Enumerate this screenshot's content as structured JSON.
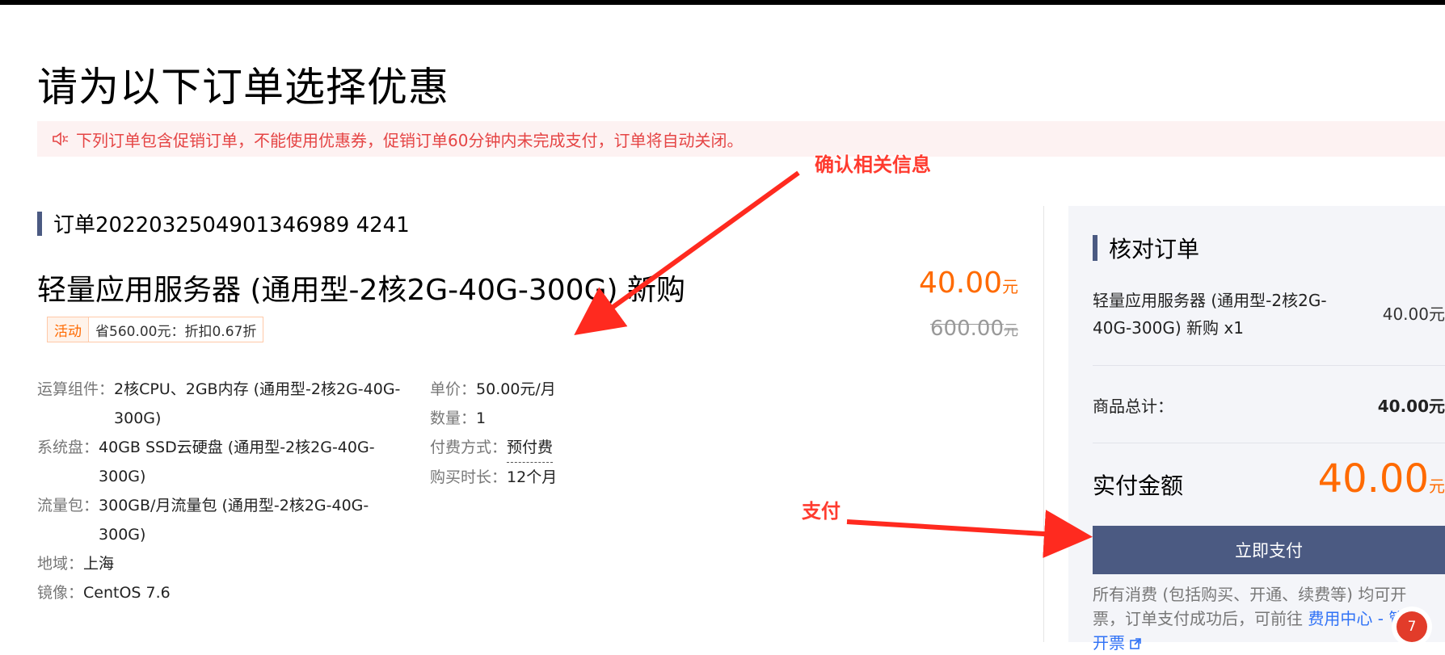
{
  "page": {
    "title": "请为以下订单选择优惠",
    "notice": "下列订单包含促销订单，不能使用优惠券，促销订单60分钟内未完成支付，订单将自动关闭。"
  },
  "order": {
    "id_label": "订单2022032504901346989 4241",
    "product_title": "轻量应用服务器 (通用型-2核2G-40G-300G) 新购",
    "price": "40.00",
    "price_unit": "元",
    "original_price": "600.00",
    "original_unit": "元",
    "promo_tag": "活动",
    "promo_text": "省560.00元：折扣0.67折",
    "specs": [
      {
        "k": "运算组件：",
        "v": "2核CPU、2GB内存 (通用型-2核2G-40G-300G)"
      },
      {
        "k": "系统盘：",
        "v": "40GB SSD云硬盘 (通用型-2核2G-40G-300G)"
      },
      {
        "k": "流量包：",
        "v": "300GB/月流量包 (通用型-2核2G-40G-300G)"
      },
      {
        "k": "地域：",
        "v": "上海"
      },
      {
        "k": "镜像：",
        "v": "CentOS 7.6"
      }
    ],
    "specs2": [
      {
        "k": "单价：",
        "v": "50.00元/月"
      },
      {
        "k": "数量：",
        "v": "1"
      },
      {
        "k": "付费方式：",
        "v": "预付费"
      },
      {
        "k": "购买时长：",
        "v": "12个月"
      }
    ]
  },
  "panel": {
    "title": "核对订单",
    "item": "轻量应用服务器 (通用型-2核2G-40G-300G) 新购 x1",
    "item_price": "40.00元",
    "total_label": "商品总计：",
    "total_value": "40.00元",
    "pay_label": "实付金额",
    "pay_value": "40.00",
    "pay_unit": "元",
    "pay_button": "立即支付",
    "footnote_a": "所有消费 (包括购买、开通、续费等) 均可开票，订单支付成功后，可前往 ",
    "footnote_link": "费用中心 - 管理开票",
    "badge": "7"
  },
  "annotations": {
    "confirm": "确认相关信息",
    "pay": "支付",
    "color": "#ff2a1f"
  },
  "colors": {
    "accent": "#ff6a00",
    "primary": "#4b5a82",
    "notice": "#e54545"
  }
}
